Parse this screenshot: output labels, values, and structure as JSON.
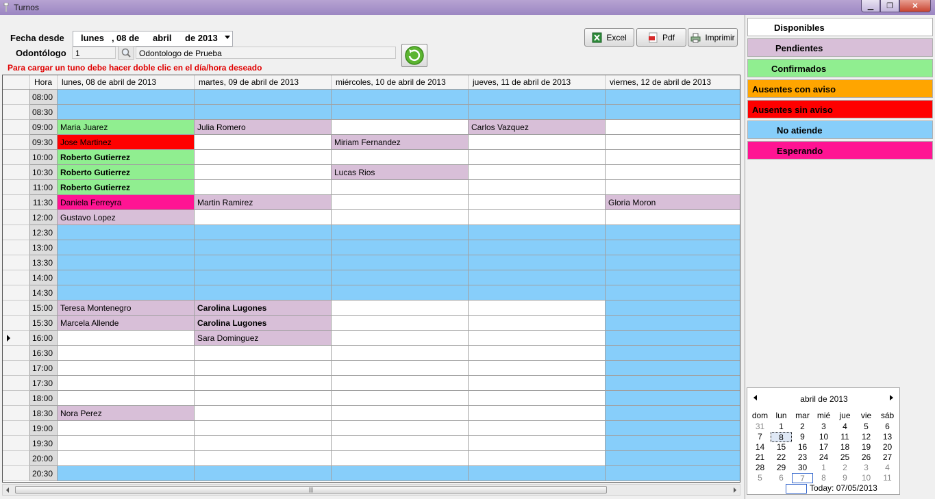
{
  "window": {
    "title": "Turnos"
  },
  "filters": {
    "fecha_label": "Fecha desde",
    "date": {
      "weekday": "lunes",
      "sep": ",",
      "day": "08 de",
      "month": "abril",
      "year": "de 2013"
    },
    "odontologo_label": "Odontólogo",
    "odontologo_id": "1",
    "odontologo_name": "Odontologo de Prueba",
    "warning": "Para cargar un tuno debe hacer doble clic en el día/hora deseado"
  },
  "toolbar": {
    "excel": "Excel",
    "pdf": "Pdf",
    "print": "Imprimir"
  },
  "grid": {
    "hora_header": "Hora",
    "days": [
      "lunes, 08 de abril de 2013",
      "martes, 09 de abril de 2013",
      "miércoles, 10 de abril de 2013",
      "jueves, 11 de abril de 2013",
      "viernes, 12 de abril de 2013"
    ],
    "rows": [
      {
        "time": "08:00",
        "cells": [
          {
            "t": "",
            "s": "na"
          },
          {
            "t": "",
            "s": "na"
          },
          {
            "t": "",
            "s": "na"
          },
          {
            "t": "",
            "s": "na"
          },
          {
            "t": "",
            "s": "na"
          }
        ]
      },
      {
        "time": "08:30",
        "cells": [
          {
            "t": "",
            "s": "na"
          },
          {
            "t": "",
            "s": "na"
          },
          {
            "t": "",
            "s": "na"
          },
          {
            "t": "",
            "s": "na"
          },
          {
            "t": "",
            "s": "na"
          }
        ]
      },
      {
        "time": "09:00",
        "cells": [
          {
            "t": "Maria Juarez",
            "s": "c"
          },
          {
            "t": "Julia Romero",
            "s": "p"
          },
          {
            "t": "",
            "s": "d"
          },
          {
            "t": "Carlos Vazquez",
            "s": "p"
          },
          {
            "t": "",
            "s": "d"
          }
        ]
      },
      {
        "time": "09:30",
        "cells": [
          {
            "t": "Jose Martinez",
            "s": "as"
          },
          {
            "t": "",
            "s": "d"
          },
          {
            "t": "Miriam Fernandez",
            "s": "p"
          },
          {
            "t": "",
            "s": "d"
          },
          {
            "t": "",
            "s": "d"
          }
        ]
      },
      {
        "time": "10:00",
        "cells": [
          {
            "t": "Roberto Gutierrez",
            "s": "c",
            "b": true
          },
          {
            "t": "",
            "s": "d"
          },
          {
            "t": "",
            "s": "d"
          },
          {
            "t": "",
            "s": "d"
          },
          {
            "t": "",
            "s": "d"
          }
        ]
      },
      {
        "time": "10:30",
        "cells": [
          {
            "t": "Roberto Gutierrez",
            "s": "c",
            "b": true
          },
          {
            "t": "",
            "s": "d"
          },
          {
            "t": "Lucas Rios",
            "s": "p"
          },
          {
            "t": "",
            "s": "d"
          },
          {
            "t": "",
            "s": "d"
          }
        ]
      },
      {
        "time": "11:00",
        "cells": [
          {
            "t": "Roberto Gutierrez",
            "s": "c",
            "b": true
          },
          {
            "t": "",
            "s": "d"
          },
          {
            "t": "",
            "s": "d"
          },
          {
            "t": "",
            "s": "d"
          },
          {
            "t": "",
            "s": "d"
          }
        ]
      },
      {
        "time": "11:30",
        "cells": [
          {
            "t": "Daniela Ferreyra",
            "s": "e"
          },
          {
            "t": "Martin Ramirez",
            "s": "p"
          },
          {
            "t": "",
            "s": "d"
          },
          {
            "t": "",
            "s": "d"
          },
          {
            "t": "Gloria Moron",
            "s": "p"
          }
        ]
      },
      {
        "time": "12:00",
        "cells": [
          {
            "t": "Gustavo Lopez",
            "s": "p"
          },
          {
            "t": "",
            "s": "d"
          },
          {
            "t": "",
            "s": "d"
          },
          {
            "t": "",
            "s": "d"
          },
          {
            "t": "",
            "s": "d"
          }
        ]
      },
      {
        "time": "12:30",
        "cells": [
          {
            "t": "",
            "s": "na"
          },
          {
            "t": "",
            "s": "na"
          },
          {
            "t": "",
            "s": "na"
          },
          {
            "t": "",
            "s": "na"
          },
          {
            "t": "",
            "s": "na"
          }
        ]
      },
      {
        "time": "13:00",
        "cells": [
          {
            "t": "",
            "s": "na"
          },
          {
            "t": "",
            "s": "na"
          },
          {
            "t": "",
            "s": "na"
          },
          {
            "t": "",
            "s": "na"
          },
          {
            "t": "",
            "s": "na"
          }
        ]
      },
      {
        "time": "13:30",
        "cells": [
          {
            "t": "",
            "s": "na"
          },
          {
            "t": "",
            "s": "na"
          },
          {
            "t": "",
            "s": "na"
          },
          {
            "t": "",
            "s": "na"
          },
          {
            "t": "",
            "s": "na"
          }
        ]
      },
      {
        "time": "14:00",
        "cells": [
          {
            "t": "",
            "s": "na"
          },
          {
            "t": "",
            "s": "na"
          },
          {
            "t": "",
            "s": "na"
          },
          {
            "t": "",
            "s": "na"
          },
          {
            "t": "",
            "s": "na"
          }
        ]
      },
      {
        "time": "14:30",
        "cells": [
          {
            "t": "",
            "s": "na"
          },
          {
            "t": "",
            "s": "na"
          },
          {
            "t": "",
            "s": "na"
          },
          {
            "t": "",
            "s": "na"
          },
          {
            "t": "",
            "s": "na"
          }
        ]
      },
      {
        "time": "15:00",
        "cells": [
          {
            "t": "Teresa Montenegro",
            "s": "p"
          },
          {
            "t": "Carolina Lugones",
            "s": "p",
            "b": true
          },
          {
            "t": "",
            "s": "d"
          },
          {
            "t": "",
            "s": "d"
          },
          {
            "t": "",
            "s": "na"
          }
        ]
      },
      {
        "time": "15:30",
        "cells": [
          {
            "t": "Marcela Allende",
            "s": "p"
          },
          {
            "t": "Carolina Lugones",
            "s": "p",
            "b": true
          },
          {
            "t": "",
            "s": "d"
          },
          {
            "t": "",
            "s": "d"
          },
          {
            "t": "",
            "s": "na"
          }
        ]
      },
      {
        "time": "16:00",
        "cells": [
          {
            "t": "",
            "s": "d"
          },
          {
            "t": "Sara Dominguez",
            "s": "p"
          },
          {
            "t": "",
            "s": "d"
          },
          {
            "t": "",
            "s": "d"
          },
          {
            "t": "",
            "s": "na"
          }
        ],
        "current": true
      },
      {
        "time": "16:30",
        "cells": [
          {
            "t": "",
            "s": "d"
          },
          {
            "t": "",
            "s": "d"
          },
          {
            "t": "",
            "s": "d"
          },
          {
            "t": "",
            "s": "d"
          },
          {
            "t": "",
            "s": "na"
          }
        ]
      },
      {
        "time": "17:00",
        "cells": [
          {
            "t": "",
            "s": "d"
          },
          {
            "t": "",
            "s": "d"
          },
          {
            "t": "",
            "s": "d"
          },
          {
            "t": "",
            "s": "d"
          },
          {
            "t": "",
            "s": "na"
          }
        ]
      },
      {
        "time": "17:30",
        "cells": [
          {
            "t": "",
            "s": "d"
          },
          {
            "t": "",
            "s": "d"
          },
          {
            "t": "",
            "s": "d"
          },
          {
            "t": "",
            "s": "d"
          },
          {
            "t": "",
            "s": "na"
          }
        ]
      },
      {
        "time": "18:00",
        "cells": [
          {
            "t": "",
            "s": "d"
          },
          {
            "t": "",
            "s": "d"
          },
          {
            "t": "",
            "s": "d"
          },
          {
            "t": "",
            "s": "d"
          },
          {
            "t": "",
            "s": "na"
          }
        ]
      },
      {
        "time": "18:30",
        "cells": [
          {
            "t": "Nora Perez",
            "s": "p"
          },
          {
            "t": "",
            "s": "d"
          },
          {
            "t": "",
            "s": "d"
          },
          {
            "t": "",
            "s": "d"
          },
          {
            "t": "",
            "s": "na"
          }
        ]
      },
      {
        "time": "19:00",
        "cells": [
          {
            "t": "",
            "s": "d"
          },
          {
            "t": "",
            "s": "d"
          },
          {
            "t": "",
            "s": "d"
          },
          {
            "t": "",
            "s": "d"
          },
          {
            "t": "",
            "s": "na"
          }
        ]
      },
      {
        "time": "19:30",
        "cells": [
          {
            "t": "",
            "s": "d"
          },
          {
            "t": "",
            "s": "d"
          },
          {
            "t": "",
            "s": "d"
          },
          {
            "t": "",
            "s": "d"
          },
          {
            "t": "",
            "s": "na"
          }
        ]
      },
      {
        "time": "20:00",
        "cells": [
          {
            "t": "",
            "s": "d"
          },
          {
            "t": "",
            "s": "d"
          },
          {
            "t": "",
            "s": "d"
          },
          {
            "t": "",
            "s": "d"
          },
          {
            "t": "",
            "s": "na"
          }
        ]
      },
      {
        "time": "20:30",
        "cells": [
          {
            "t": "",
            "s": "na"
          },
          {
            "t": "",
            "s": "na"
          },
          {
            "t": "",
            "s": "na"
          },
          {
            "t": "",
            "s": "na"
          },
          {
            "t": "",
            "s": "na"
          }
        ]
      }
    ]
  },
  "status_colors": {
    "d": "#ffffff",
    "p": "#d8bfd8",
    "c": "#90ee90",
    "aa": "#ffa500",
    "as": "#ff0000",
    "na": "#87cefa",
    "e": "#ff1493"
  },
  "legend": [
    {
      "key": "d",
      "label": "Disponibles"
    },
    {
      "key": "p",
      "label": "Pendientes"
    },
    {
      "key": "c",
      "label": "Confirmados"
    },
    {
      "key": "aa",
      "label": "Ausentes con aviso"
    },
    {
      "key": "as",
      "label": "Ausentes sin aviso"
    },
    {
      "key": "na",
      "label": "No atiende"
    },
    {
      "key": "e",
      "label": "Esperando"
    }
  ],
  "calendar": {
    "month_label": "abril de 2013",
    "dow": [
      "dom",
      "lun",
      "mar",
      "mié",
      "jue",
      "vie",
      "sáb"
    ],
    "weeks": [
      [
        "31",
        "1",
        "2",
        "3",
        "4",
        "5",
        "6"
      ],
      [
        "7",
        "8",
        "9",
        "10",
        "11",
        "12",
        "13"
      ],
      [
        "14",
        "15",
        "16",
        "17",
        "18",
        "19",
        "20"
      ],
      [
        "21",
        "22",
        "23",
        "24",
        "25",
        "26",
        "27"
      ],
      [
        "28",
        "29",
        "30",
        "1",
        "2",
        "3",
        "4"
      ],
      [
        "5",
        "6",
        "7",
        "8",
        "9",
        "10",
        "11"
      ]
    ],
    "selected": "8",
    "today_label": "Today: 07/05/2013"
  }
}
